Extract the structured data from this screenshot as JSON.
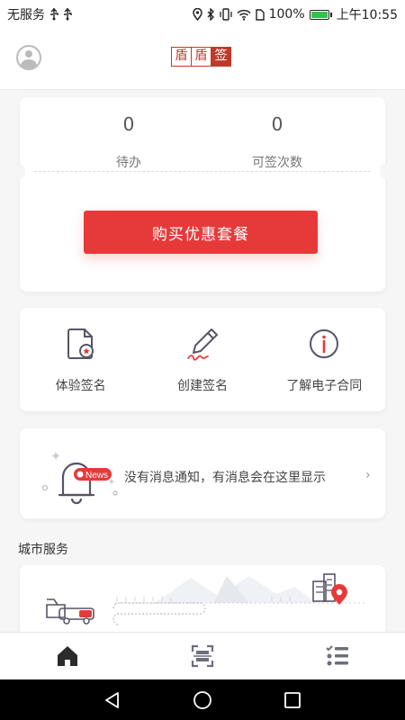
{
  "status_bar": {
    "carrier": "无服务",
    "battery": "100%",
    "battery_level": 1.0,
    "time": "上午10:55"
  },
  "header": {
    "logo_chars": [
      "盾",
      "盾",
      "签"
    ]
  },
  "stats": {
    "pending_value": "0",
    "pending_label": "待办",
    "count_value": "0",
    "count_label": "可签次数",
    "buy_button": "购买优惠套餐"
  },
  "actions": [
    {
      "label": "体验签名",
      "icon": "document-star-icon"
    },
    {
      "label": "创建签名",
      "icon": "pen-sign-icon"
    },
    {
      "label": "了解电子合同",
      "icon": "info-icon"
    }
  ],
  "notice": {
    "badge": "News",
    "text": "没有消息通知，有消息会在这里显示",
    "arrow": "›"
  },
  "city_service": {
    "title": "城市服务"
  },
  "tabs": [
    {
      "name": "home",
      "icon": "home-icon",
      "active": true
    },
    {
      "name": "scan",
      "icon": "scan-icon",
      "active": false
    },
    {
      "name": "list",
      "icon": "list-icon",
      "active": false
    }
  ],
  "colors": {
    "accent": "#e63a3a",
    "logo": "#c0392b",
    "battery": "#33c24d"
  }
}
